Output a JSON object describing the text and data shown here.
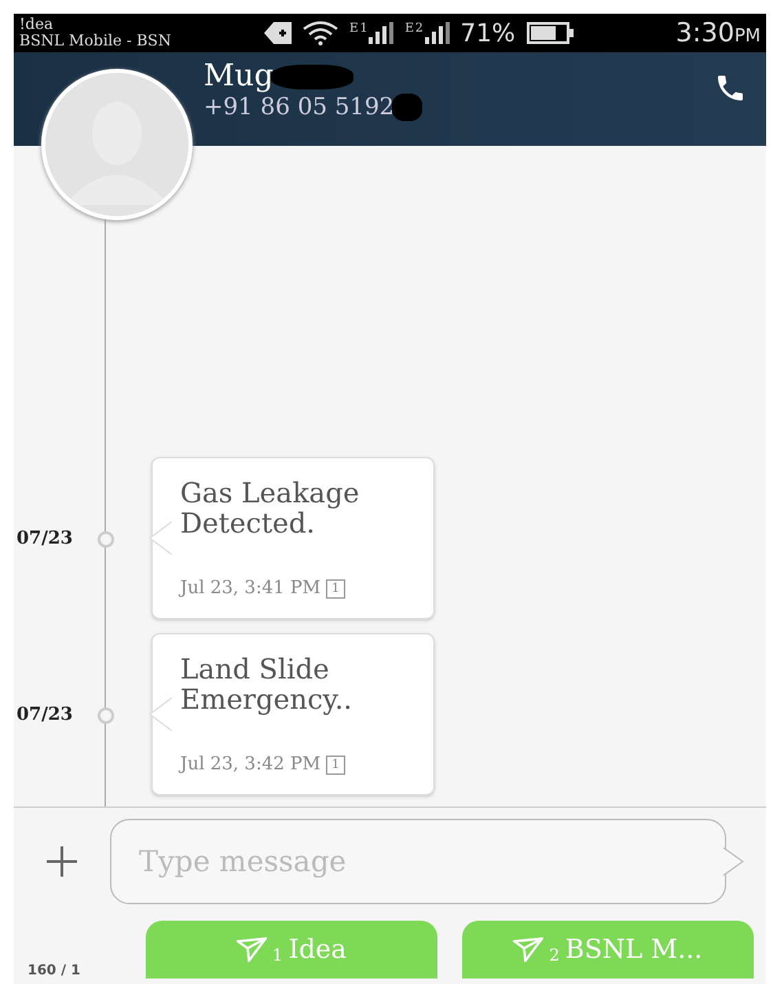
{
  "status_bar": {
    "carrier_1": "!dea",
    "carrier_2": "BSNL Mobile - BSN",
    "sim_1": "1",
    "sim_2": "2",
    "network_1": "E",
    "network_2": "E",
    "battery": "71%",
    "time": "3:30",
    "ampm": "PM"
  },
  "header": {
    "name": "Mug",
    "number": "+91 86 05 5192"
  },
  "messages": [
    {
      "date": "07/23",
      "text": "Gas Leakage Detected.",
      "time": "Jul 23, 3:41 PM",
      "sim": "1"
    },
    {
      "date": "07/23",
      "text": "Land Slide Emergency..",
      "time": "Jul 23, 3:42 PM",
      "sim": "1"
    }
  ],
  "composer": {
    "placeholder": "Type message",
    "counter": "160 / 1"
  },
  "send_buttons": [
    {
      "sim": "1",
      "label": "Idea"
    },
    {
      "sim": "2",
      "label": "BSNL M..."
    }
  ]
}
